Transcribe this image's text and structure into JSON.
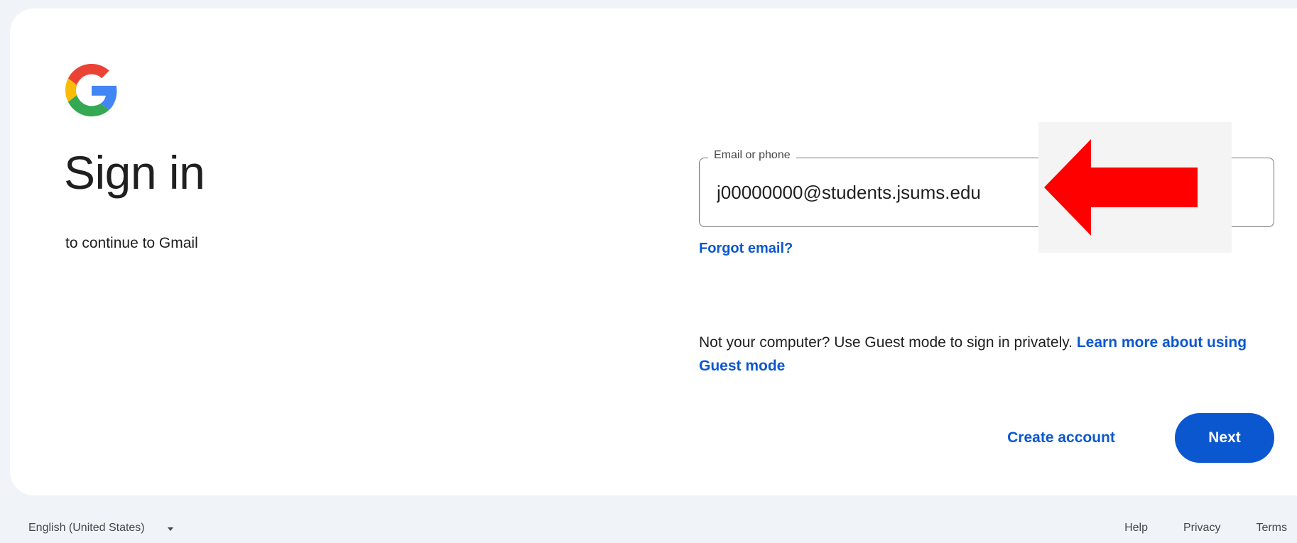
{
  "signin": {
    "logo": {
      "icon": "google-g-icon",
      "colors": {
        "blue": "#4285f4",
        "red": "#ea4335",
        "yellow": "#fbbc05",
        "green": "#34a853"
      }
    },
    "title": "Sign in",
    "subtitle": "to continue to Gmail",
    "email_field": {
      "label": "Email or phone",
      "value": "j00000000@students.jsums.edu"
    },
    "forgot_email_label": "Forgot email?",
    "guest_text": "Not your computer? Use Guest mode to sign in privately.",
    "guest_link_label": "Learn more about using Guest mode",
    "annotation": {
      "icon": "left-arrow-icon",
      "color": "#ff0000"
    },
    "actions": {
      "create_account_label": "Create account",
      "next_label": "Next",
      "accent": "#0b57d0"
    }
  },
  "footer": {
    "language": "English (United States)",
    "language_icon": "chevron-down-icon",
    "links": [
      "Help",
      "Privacy",
      "Terms"
    ]
  }
}
